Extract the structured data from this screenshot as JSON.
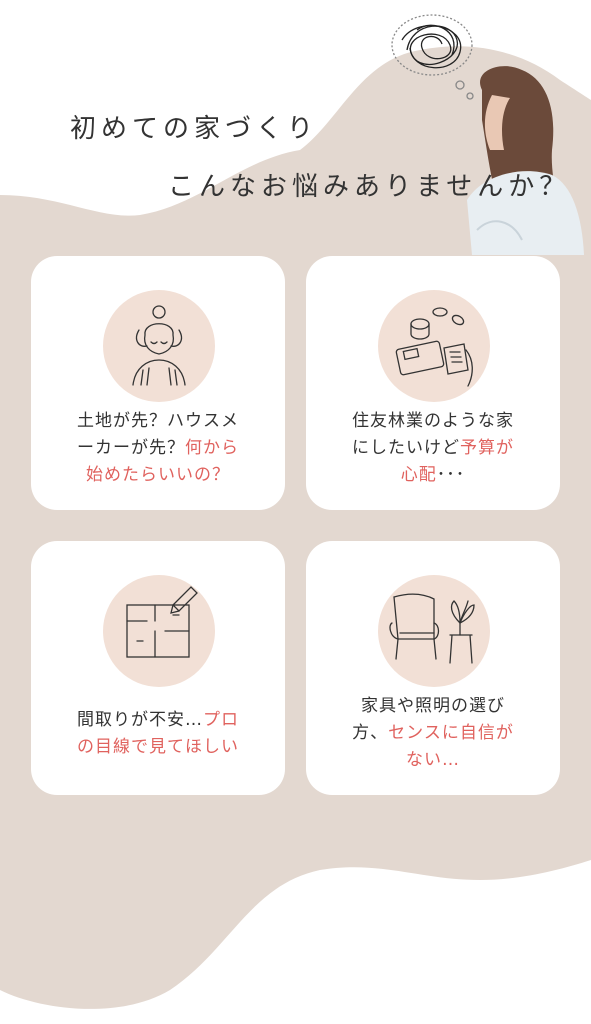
{
  "heading": {
    "line1": "初めての家づくり",
    "line2": "こんなお悩みありませんか？"
  },
  "cards": [
    {
      "icon": "stressed-woman-icon",
      "lines": [
        {
          "parts": [
            {
              "t": "土地が先？ハウスメ",
              "hl": false
            }
          ]
        },
        {
          "parts": [
            {
              "t": "ーカーが先？",
              "hl": false
            },
            {
              "t": "何から",
              "hl": true
            }
          ]
        },
        {
          "parts": [
            {
              "t": "始めたらいいの？",
              "hl": true
            }
          ]
        }
      ]
    },
    {
      "icon": "calculator-coins-icon",
      "lines": [
        {
          "parts": [
            {
              "t": "住友林業のような家",
              "hl": false
            }
          ]
        },
        {
          "parts": [
            {
              "t": "にしたいけど",
              "hl": false
            },
            {
              "t": "予算が",
              "hl": true
            }
          ]
        },
        {
          "parts": [
            {
              "t": "心配",
              "hl": true
            },
            {
              "t": "･･･",
              "hl": false
            }
          ]
        }
      ]
    },
    {
      "icon": "floor-plan-pencil-icon",
      "lines": [
        {
          "parts": [
            {
              "t": "間取りが不安…",
              "hl": false
            },
            {
              "t": "プロ",
              "hl": true
            }
          ]
        },
        {
          "parts": [
            {
              "t": "の目線で見てほしい",
              "hl": true
            }
          ]
        }
      ]
    },
    {
      "icon": "armchair-plant-icon",
      "lines": [
        {
          "parts": [
            {
              "t": "家具や照明の選び",
              "hl": false
            }
          ]
        },
        {
          "parts": [
            {
              "t": "方、",
              "hl": false
            },
            {
              "t": "センスに自信が",
              "hl": true
            }
          ]
        },
        {
          "parts": [
            {
              "t": "ない…",
              "hl": true
            }
          ]
        }
      ]
    }
  ],
  "colors": {
    "background_blob": "#e3d8d0",
    "card": "#ffffff",
    "icon_circle": "#f2e0d6",
    "highlight": "#e0625e",
    "text": "#333333"
  }
}
